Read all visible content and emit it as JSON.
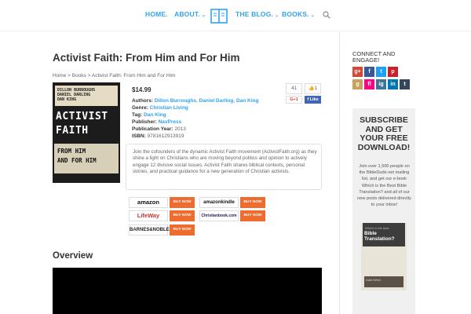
{
  "nav": {
    "home": "HOME.",
    "about": "ABOUT.",
    "blog": "THE BLOG.",
    "books": "BOOKS."
  },
  "icons": {
    "logo": "book-logo-icon",
    "search": "search-icon",
    "chevron": "chevron-down-icon"
  },
  "colors": {
    "accent": "#2ea3f2",
    "buy_button": "#ef6b2e",
    "facebook": "#4267b2"
  },
  "page": {
    "title": "Activist Faith: From Him and For Him",
    "breadcrumb": "Home > Books > Activist Faith: From Him and For Him"
  },
  "cover": {
    "authors_line1": "DILLON BURROUGHS",
    "authors_line2": "DANIEL DARLING",
    "authors_line3": "DAN KING",
    "title_line1": "ACTIVIST",
    "title_line2": "FAITH",
    "subtitle_line1": "FROM HIM",
    "subtitle_line2": "AND FOR HIM"
  },
  "book": {
    "price": "$14.99",
    "authors_label": "Authors:",
    "author1": "Dillon Burroughs",
    "author2": "Daniel Darling",
    "author3": "Dan King",
    "genre_label": "Genre:",
    "genre": "Christian Living",
    "tag_label": "Tag:",
    "tag": "Dan King",
    "publisher_label": "Publisher:",
    "publisher": "NavPress",
    "year_label": "Publication Year:",
    "year": "2013",
    "isbn_label": "ISBN:",
    "isbn": "9781612913919",
    "description": "Join the cofounders of the dynamic Activist Faith movement (ActivistFaith.org) as they shine a light on Christians who are moving beyond politics and opinion to actively engage 12 divisive social issues. Activist Faith shares biblical contexts, personal stories, and practical guidance for a new generation of Christian activists."
  },
  "share": {
    "count": "41",
    "like": "1",
    "google": "G+1",
    "facebook": "f Like"
  },
  "stores": {
    "amazon": "amazon",
    "kindle": "amazonkindle",
    "lifeway": "LifeWay",
    "christianbook": "Christianbook.com",
    "bn": "BARNES&NOBLE",
    "buy_label": "BUY NOW"
  },
  "overview": {
    "heading": "Overview"
  },
  "sidebar": {
    "connect_title": "CONNECT AND ENGAGE!",
    "social": [
      "g+",
      "f",
      "t",
      "p",
      "g",
      "fl",
      "ig",
      "in",
      "t"
    ],
    "subscribe_title": "SUBSCRIBE AND GET YOUR FREE DOWNLOAD!",
    "subscribe_body": "Join over 1,500 people on the BibleDude.net mailing list, and get our e-book Which is the Best Bible Translation? and all of our new posts delivered directly to your inbox!",
    "ebook_small": "Which is the best",
    "ebook_title": "Bible Translation?",
    "ebook_author": "DAN KING"
  }
}
